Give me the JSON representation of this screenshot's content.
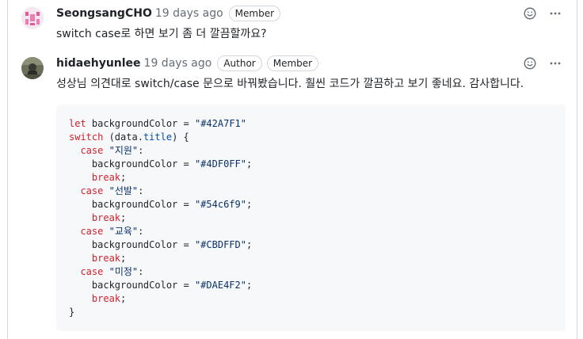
{
  "comments": [
    {
      "author": "SeongsangCHO",
      "time": "19 days ago",
      "badges": [
        "Member"
      ],
      "avatar": "identicon-avatar",
      "body": "switch case로 하면 보기 좀 더 깔끔할까요?"
    },
    {
      "author": "hidaehyunlee",
      "time": "19 days ago",
      "badges": [
        "Author",
        "Member"
      ],
      "avatar": "photo-avatar",
      "body": "성상님 의견대로 switch/case 문으로 바꿔봤습니다. 훨씬 코드가 깔끔하고 보기 좋네요. 감사합니다."
    }
  ],
  "icons": {
    "reaction": "smiley-icon",
    "menu": "kebab-horizontal-icon"
  },
  "code": {
    "line1": {
      "kw": "let",
      "rest": " backgroundColor = ",
      "str": "\"#42A7F1\""
    },
    "line2": {
      "kw": "switch",
      "pre": " (data.",
      "prop": "title",
      "post": ") {"
    },
    "cases": [
      {
        "kw": "case",
        "label": "\"지원\"",
        "assign": "backgroundColor = ",
        "color": "\"#4DF0FF\"",
        "brk": "break"
      },
      {
        "kw": "case",
        "label": "\"선발\"",
        "assign": "backgroundColor = ",
        "color": "\"#54c6f9\"",
        "brk": "break"
      },
      {
        "kw": "case",
        "label": "\"교육\"",
        "assign": "backgroundColor = ",
        "color": "\"#CBDFFD\"",
        "brk": "break"
      },
      {
        "kw": "case",
        "label": "\"미정\"",
        "assign": "backgroundColor = ",
        "color": "\"#DAE4F2\"",
        "brk": "break"
      }
    ],
    "close": "}"
  },
  "colors": {
    "keyword": "#cf222e",
    "string": "#0a3069",
    "property": "#0550ae",
    "code_bg": "#f6f8fa",
    "muted": "#656d76"
  }
}
